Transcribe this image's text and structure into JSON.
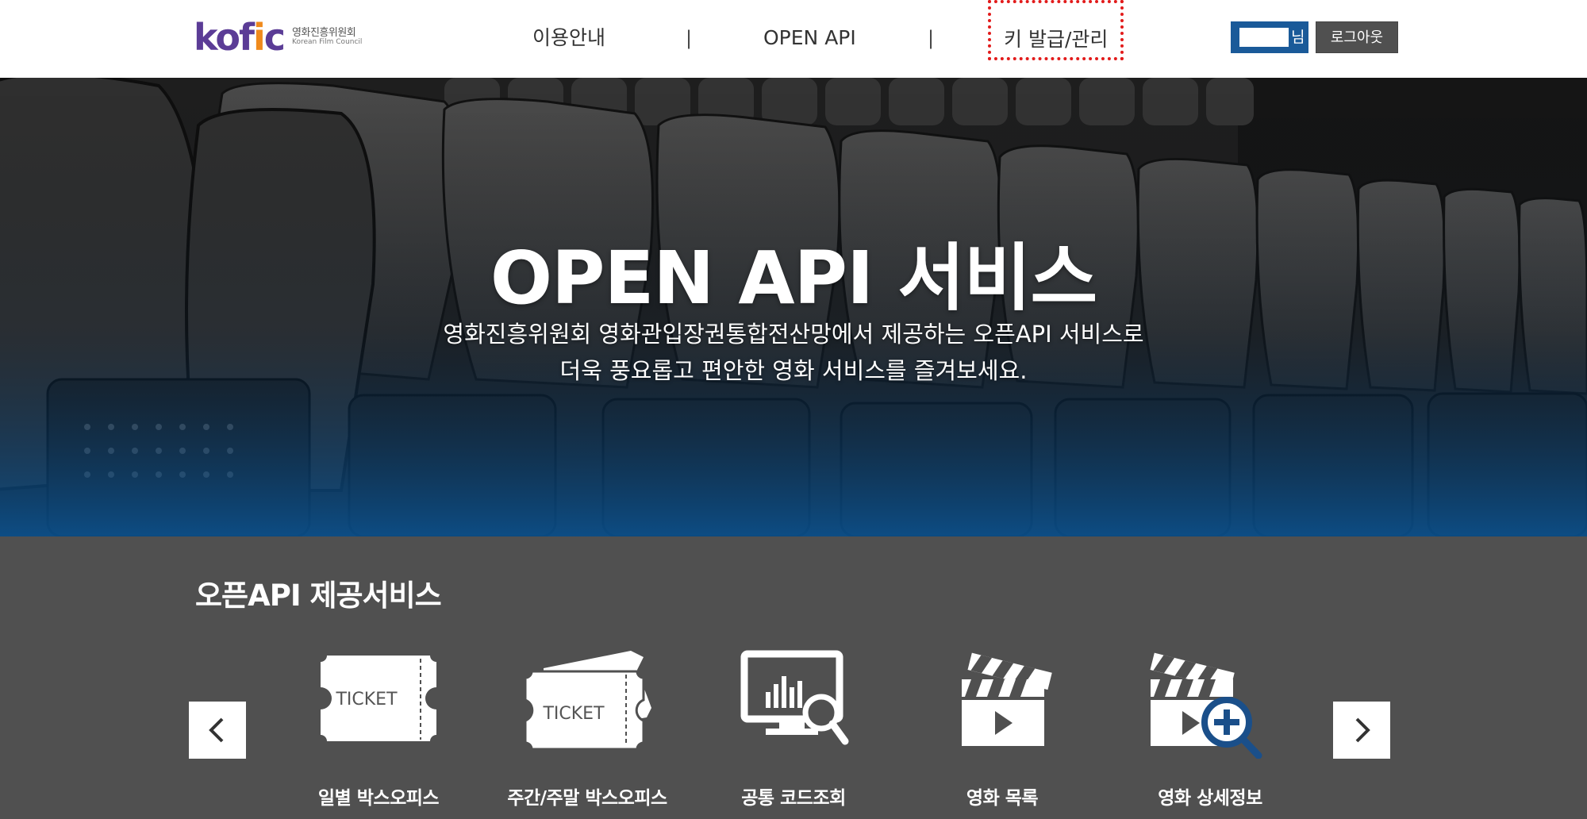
{
  "brand": {
    "logo_mark_ko": "kofic",
    "logo_ko": "영화진흥위원회",
    "logo_en": "Korean Film Council"
  },
  "nav": {
    "items": [
      {
        "label": "이용안내"
      },
      {
        "label": "OPEN API"
      },
      {
        "label": "키 발급/관리"
      }
    ],
    "separator": "|"
  },
  "user": {
    "name": "",
    "suffix": "님",
    "logout_label": "로그아웃"
  },
  "hero": {
    "title": "OPEN API 서비스",
    "subtitle_line1": "영화진흥위원회 영화관입장권통합전산망에서 제공하는 오픈API 서비스로",
    "subtitle_line2": "더욱 풍요롭고 편안한 영화 서비스를 즐겨보세요."
  },
  "services": {
    "title": "오픈API 제공서비스",
    "items": [
      {
        "label": "일별 박스오피스",
        "icon": "ticket-icon",
        "icon_text": "TICKET"
      },
      {
        "label": "주간/주말 박스오피스",
        "icon": "double-ticket-icon",
        "icon_text": "TICKET"
      },
      {
        "label": "공통 코드조회",
        "icon": "monitor-chart-search-icon"
      },
      {
        "label": "영화 목록",
        "icon": "clapperboard-icon"
      },
      {
        "label": "영화 상세정보",
        "icon": "clapperboard-zoom-icon"
      }
    ],
    "prev_icon": "chevron-left-icon",
    "next_icon": "chevron-right-icon"
  },
  "colors": {
    "brand_purple": "#5b3c96",
    "brand_orange": "#f08a1c",
    "user_blue": "#1a5a99",
    "logout_gray": "#505050",
    "section_gray": "#505050",
    "highlight_red": "#e21b1b"
  }
}
